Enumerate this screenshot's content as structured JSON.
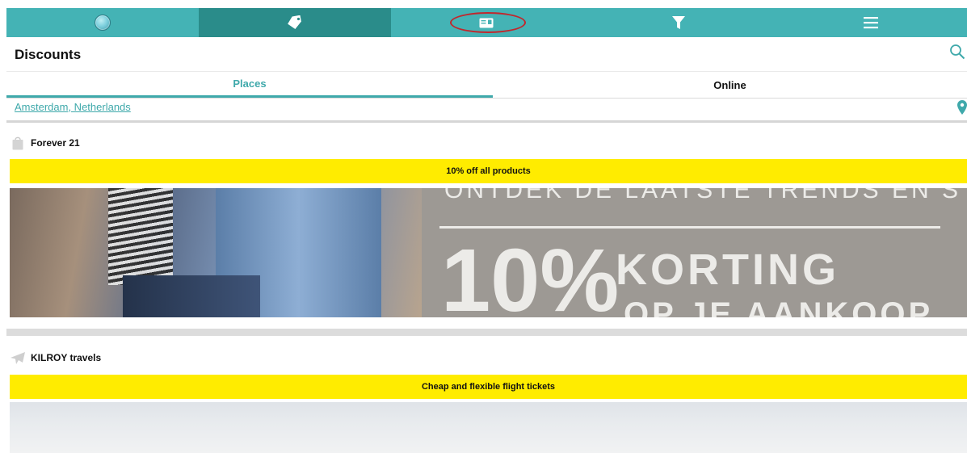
{
  "nav": {
    "items": [
      {
        "id": "home",
        "icon": "globe-icon"
      },
      {
        "id": "discounts",
        "icon": "tag-icon",
        "active": true
      },
      {
        "id": "card",
        "icon": "id-card-icon",
        "highlighted": true
      },
      {
        "id": "filter",
        "icon": "filter-icon"
      },
      {
        "id": "menu",
        "icon": "hamburger-menu-icon"
      }
    ],
    "accent_color": "#44b3b5",
    "active_color": "#2a8c8a"
  },
  "header": {
    "title": "Discounts",
    "search_icon": "search-icon"
  },
  "tabs": [
    {
      "label": "Places",
      "active": true
    },
    {
      "label": "Online",
      "active": false
    }
  ],
  "location": {
    "label": "Amsterdam, Netherlands",
    "icon": "map-pin-icon"
  },
  "offers": [
    {
      "name": "Forever 21",
      "icon": "shopping-bag-icon",
      "promo": "10% off all products",
      "banner_text": [
        "ONTDEK DE LAATSTE TRENDS EN STYLES",
        "10%",
        "KORTING",
        "OP JE AANKOOP"
      ]
    },
    {
      "name": "KILROY travels",
      "icon": "airplane-icon",
      "promo": "Cheap and flexible flight tickets"
    }
  ],
  "colors": {
    "promo_bar": "#ffec00",
    "link": "#3fa9ab"
  }
}
